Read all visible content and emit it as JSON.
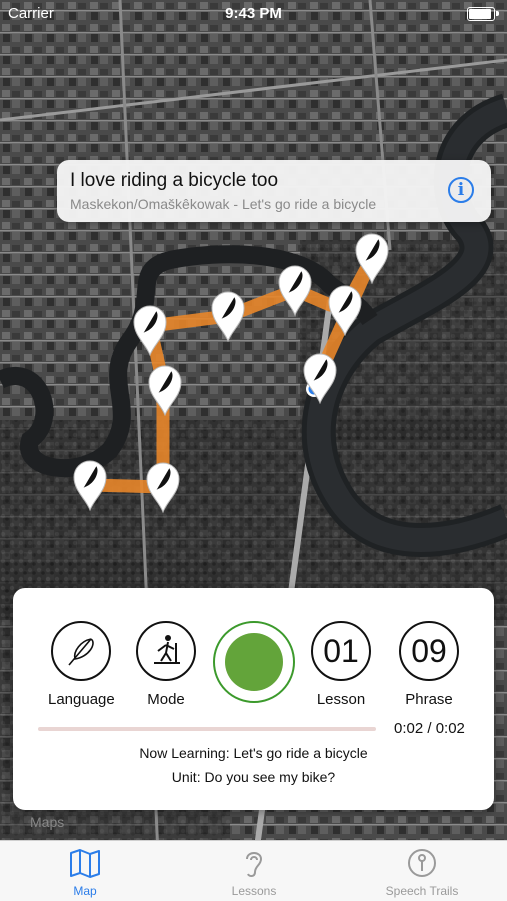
{
  "status": {
    "carrier": "Carrier",
    "time": "9:43 PM"
  },
  "callout": {
    "title": "I love riding a bicycle too",
    "subtitle": "Maskekon/Omaškêkowak - Let's go ride a bicycle",
    "info_icon": "info-icon"
  },
  "controls": {
    "language_label": "Language",
    "mode_label": "Mode",
    "lesson_number": "01",
    "lesson_label": "Lesson",
    "phrase_number": "09",
    "phrase_label": "Phrase"
  },
  "player": {
    "progress": 0.0,
    "time": "0:02 / 0:02"
  },
  "learning": {
    "now": "Now Learning: Let's go ride a bicycle",
    "unit": "Unit: Do you see my bike?"
  },
  "map": {
    "legal": "Maps",
    "route_color": "#e8862a"
  },
  "tabs": [
    {
      "label": "Map",
      "icon": "map-icon",
      "color": "#2b7de9"
    },
    {
      "label": "Lessons",
      "icon": "ear-icon",
      "color": "#9a9a9a"
    },
    {
      "label": "Speech Trails",
      "icon": "pin-icon",
      "color": "#9a9a9a"
    }
  ]
}
